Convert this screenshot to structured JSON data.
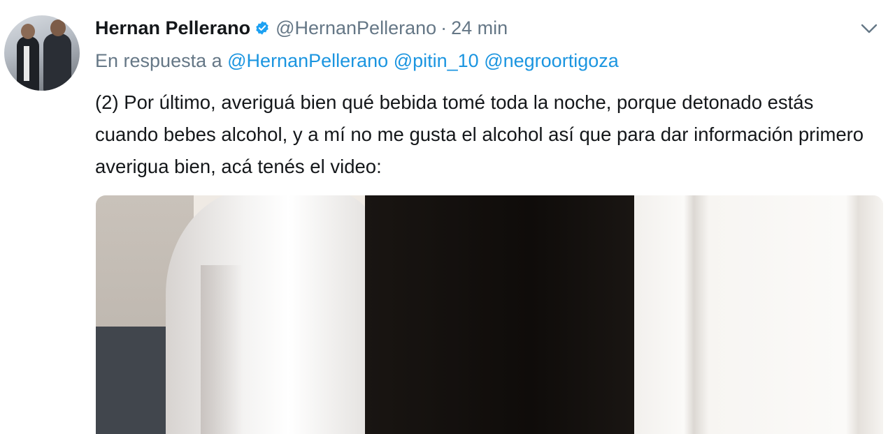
{
  "tweet": {
    "author_name": "Hernan Pellerano",
    "handle": "@HernanPellerano",
    "separator": "·",
    "time": "24 min",
    "reply_prefix": "En respuesta a",
    "mentions": [
      "@HernanPellerano",
      "@pitin_10",
      "@negroortigoza"
    ],
    "text": "(2) Por último, averiguá bien qué bebida tomé toda la noche, porque detonado estás cuando bebes alcohol, y a mí no me gusta el alcohol así que para dar información primero averigua bien, acá tenés el video:",
    "icons": {
      "verified": "verified-badge-icon",
      "menu": "chevron-down-icon"
    },
    "colors": {
      "text": "#14171a",
      "secondary": "#657786",
      "link": "#1b95e0",
      "verified": "#1da1f2"
    }
  }
}
